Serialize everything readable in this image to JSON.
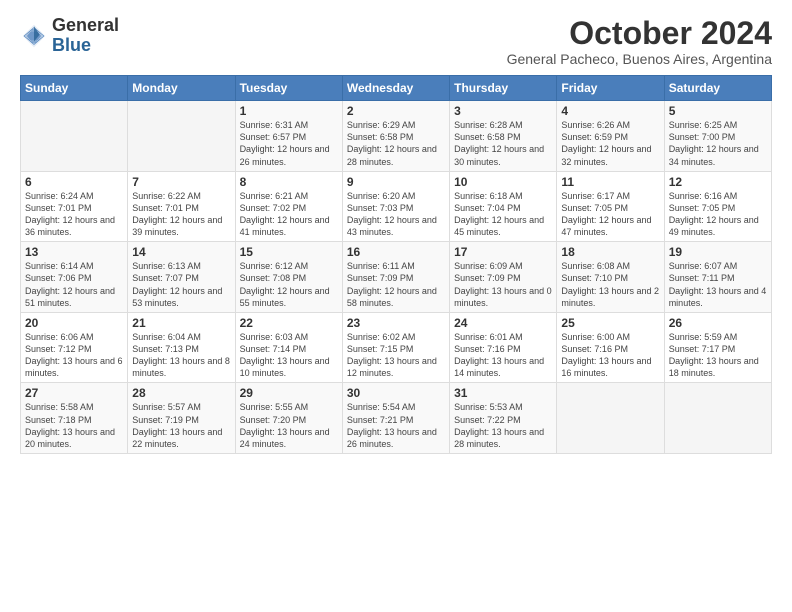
{
  "logo": {
    "general": "General",
    "blue": "Blue"
  },
  "header": {
    "month": "October 2024",
    "location": "General Pacheco, Buenos Aires, Argentina"
  },
  "weekdays": [
    "Sunday",
    "Monday",
    "Tuesday",
    "Wednesday",
    "Thursday",
    "Friday",
    "Saturday"
  ],
  "weeks": [
    [
      {
        "day": "",
        "info": ""
      },
      {
        "day": "",
        "info": ""
      },
      {
        "day": "1",
        "info": "Sunrise: 6:31 AM\nSunset: 6:57 PM\nDaylight: 12 hours and 26 minutes."
      },
      {
        "day": "2",
        "info": "Sunrise: 6:29 AM\nSunset: 6:58 PM\nDaylight: 12 hours and 28 minutes."
      },
      {
        "day": "3",
        "info": "Sunrise: 6:28 AM\nSunset: 6:58 PM\nDaylight: 12 hours and 30 minutes."
      },
      {
        "day": "4",
        "info": "Sunrise: 6:26 AM\nSunset: 6:59 PM\nDaylight: 12 hours and 32 minutes."
      },
      {
        "day": "5",
        "info": "Sunrise: 6:25 AM\nSunset: 7:00 PM\nDaylight: 12 hours and 34 minutes."
      }
    ],
    [
      {
        "day": "6",
        "info": "Sunrise: 6:24 AM\nSunset: 7:01 PM\nDaylight: 12 hours and 36 minutes."
      },
      {
        "day": "7",
        "info": "Sunrise: 6:22 AM\nSunset: 7:01 PM\nDaylight: 12 hours and 39 minutes."
      },
      {
        "day": "8",
        "info": "Sunrise: 6:21 AM\nSunset: 7:02 PM\nDaylight: 12 hours and 41 minutes."
      },
      {
        "day": "9",
        "info": "Sunrise: 6:20 AM\nSunset: 7:03 PM\nDaylight: 12 hours and 43 minutes."
      },
      {
        "day": "10",
        "info": "Sunrise: 6:18 AM\nSunset: 7:04 PM\nDaylight: 12 hours and 45 minutes."
      },
      {
        "day": "11",
        "info": "Sunrise: 6:17 AM\nSunset: 7:05 PM\nDaylight: 12 hours and 47 minutes."
      },
      {
        "day": "12",
        "info": "Sunrise: 6:16 AM\nSunset: 7:05 PM\nDaylight: 12 hours and 49 minutes."
      }
    ],
    [
      {
        "day": "13",
        "info": "Sunrise: 6:14 AM\nSunset: 7:06 PM\nDaylight: 12 hours and 51 minutes."
      },
      {
        "day": "14",
        "info": "Sunrise: 6:13 AM\nSunset: 7:07 PM\nDaylight: 12 hours and 53 minutes."
      },
      {
        "day": "15",
        "info": "Sunrise: 6:12 AM\nSunset: 7:08 PM\nDaylight: 12 hours and 55 minutes."
      },
      {
        "day": "16",
        "info": "Sunrise: 6:11 AM\nSunset: 7:09 PM\nDaylight: 12 hours and 58 minutes."
      },
      {
        "day": "17",
        "info": "Sunrise: 6:09 AM\nSunset: 7:09 PM\nDaylight: 13 hours and 0 minutes."
      },
      {
        "day": "18",
        "info": "Sunrise: 6:08 AM\nSunset: 7:10 PM\nDaylight: 13 hours and 2 minutes."
      },
      {
        "day": "19",
        "info": "Sunrise: 6:07 AM\nSunset: 7:11 PM\nDaylight: 13 hours and 4 minutes."
      }
    ],
    [
      {
        "day": "20",
        "info": "Sunrise: 6:06 AM\nSunset: 7:12 PM\nDaylight: 13 hours and 6 minutes."
      },
      {
        "day": "21",
        "info": "Sunrise: 6:04 AM\nSunset: 7:13 PM\nDaylight: 13 hours and 8 minutes."
      },
      {
        "day": "22",
        "info": "Sunrise: 6:03 AM\nSunset: 7:14 PM\nDaylight: 13 hours and 10 minutes."
      },
      {
        "day": "23",
        "info": "Sunrise: 6:02 AM\nSunset: 7:15 PM\nDaylight: 13 hours and 12 minutes."
      },
      {
        "day": "24",
        "info": "Sunrise: 6:01 AM\nSunset: 7:16 PM\nDaylight: 13 hours and 14 minutes."
      },
      {
        "day": "25",
        "info": "Sunrise: 6:00 AM\nSunset: 7:16 PM\nDaylight: 13 hours and 16 minutes."
      },
      {
        "day": "26",
        "info": "Sunrise: 5:59 AM\nSunset: 7:17 PM\nDaylight: 13 hours and 18 minutes."
      }
    ],
    [
      {
        "day": "27",
        "info": "Sunrise: 5:58 AM\nSunset: 7:18 PM\nDaylight: 13 hours and 20 minutes."
      },
      {
        "day": "28",
        "info": "Sunrise: 5:57 AM\nSunset: 7:19 PM\nDaylight: 13 hours and 22 minutes."
      },
      {
        "day": "29",
        "info": "Sunrise: 5:55 AM\nSunset: 7:20 PM\nDaylight: 13 hours and 24 minutes."
      },
      {
        "day": "30",
        "info": "Sunrise: 5:54 AM\nSunset: 7:21 PM\nDaylight: 13 hours and 26 minutes."
      },
      {
        "day": "31",
        "info": "Sunrise: 5:53 AM\nSunset: 7:22 PM\nDaylight: 13 hours and 28 minutes."
      },
      {
        "day": "",
        "info": ""
      },
      {
        "day": "",
        "info": ""
      }
    ]
  ]
}
